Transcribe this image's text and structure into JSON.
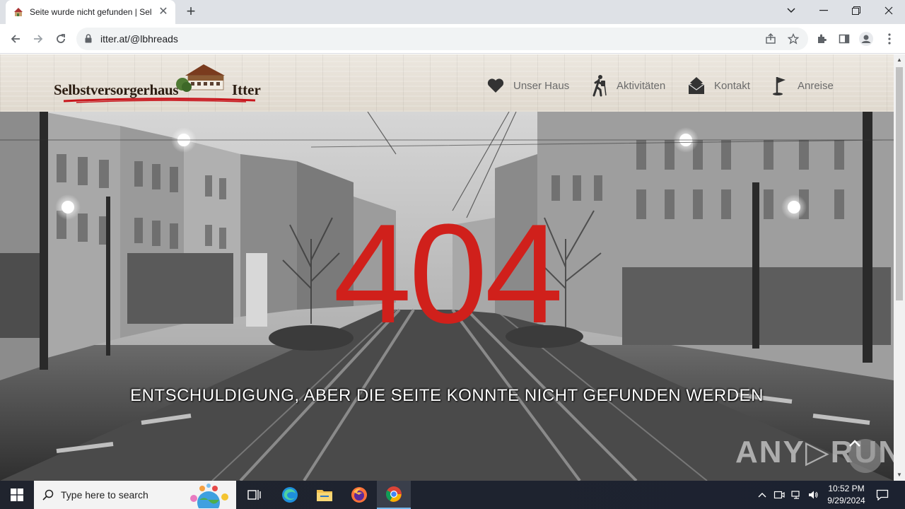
{
  "browser": {
    "tab_title": "Seite wurde nicht gefunden | Sel",
    "url": "itter.at/@lbhreads",
    "close_symbol": "✕",
    "new_tab_symbol": "+",
    "window_controls": [
      "⌄",
      "—",
      "❐",
      "✕"
    ]
  },
  "site": {
    "logo_left": "Selbstversorgerhaus",
    "logo_right": "Itter",
    "nav": [
      {
        "label": "Unser Haus",
        "icon": "heart-icon"
      },
      {
        "label": "Aktivitäten",
        "icon": "hiker-icon"
      },
      {
        "label": "Kontakt",
        "icon": "mail-icon"
      },
      {
        "label": "Anreise",
        "icon": "flag-icon"
      }
    ]
  },
  "error": {
    "code": "404",
    "message": "ENTSCHULDIGUNG, ABER DIE SEITE KONNTE NICHT GEFUNDEN WERDEN"
  },
  "watermark": "ANY▷RUN",
  "taskbar": {
    "search_placeholder": "Type here to search",
    "time": "10:52 PM",
    "date": "9/29/2024"
  },
  "colors": {
    "error_red": "#d0201b",
    "taskbar_bg": "#20242e",
    "logo_swoosh": "#c8161d"
  }
}
